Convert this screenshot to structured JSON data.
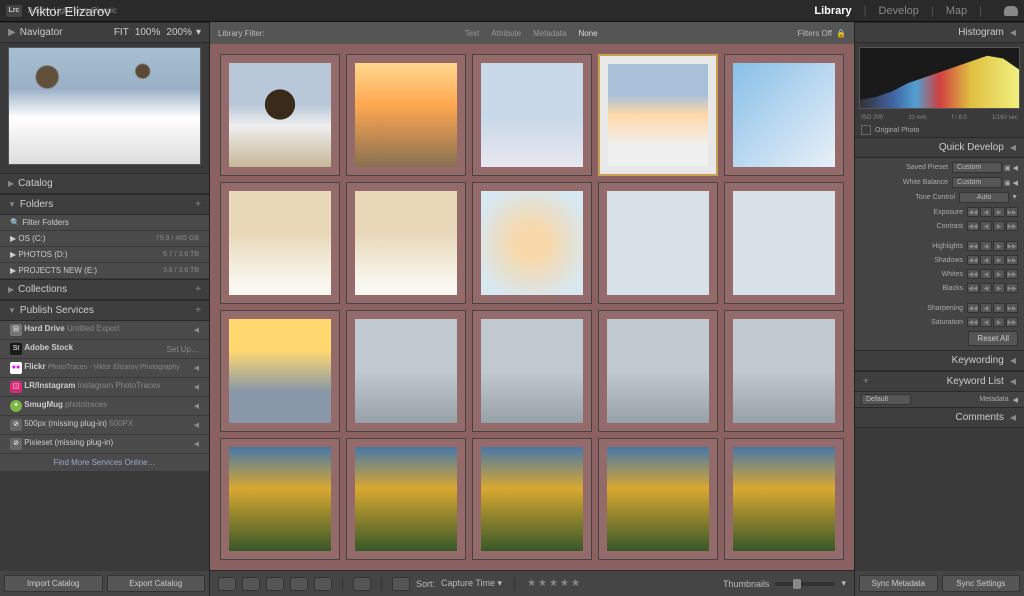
{
  "app": {
    "name": "Adobe Lightroom Classic",
    "user": "Viktor Elizarov"
  },
  "modules": {
    "library": "Library",
    "develop": "Develop",
    "map": "Map"
  },
  "navigator": {
    "title": "Navigator",
    "fit": "FIT",
    "z100": "100%",
    "z200": "200%"
  },
  "catalog": {
    "title": "Catalog"
  },
  "folders": {
    "title": "Folders",
    "filter": "Filter Folders",
    "drives": [
      {
        "name": "OS (C:)",
        "info": "79.9 / 465 GB"
      },
      {
        "name": "PHOTOS (D:)",
        "info": "6.7 / 3.6 TB"
      },
      {
        "name": "PROJECTS NEW (E:)",
        "info": "3.6 / 3.6 TB"
      }
    ]
  },
  "collections": {
    "title": "Collections"
  },
  "publish": {
    "title": "Publish Services",
    "find_more": "Find More Services Online…",
    "services": [
      {
        "icon": "hd",
        "name": "Hard Drive",
        "sub": "Untitled Export"
      },
      {
        "icon": "st",
        "name": "Adobe Stock",
        "sub": "Set Up…"
      },
      {
        "icon": "fl",
        "name": "Flickr",
        "sub": "PhotoTraces - Viktor Elizarov Photography"
      },
      {
        "icon": "ig",
        "name": "LR/Instagram",
        "sub": "Instagram PhotoTraces"
      },
      {
        "icon": "sm",
        "name": "SmugMug",
        "sub": "phototraces"
      },
      {
        "icon": "",
        "name": "500px (missing plug-in)",
        "sub": "500PX"
      },
      {
        "icon": "",
        "name": "Pixieset (missing plug-in)",
        "sub": ""
      }
    ]
  },
  "left_buttons": {
    "import": "Import Catalog",
    "export": "Export Catalog"
  },
  "filter": {
    "label": "Library Filter:",
    "text": "Text",
    "attribute": "Attribute",
    "metadata": "Metadata",
    "none": "None",
    "filters_off": "Filters Off"
  },
  "toolbar": {
    "sort": "Sort:",
    "sort_by": "Capture Time",
    "thumbnails": "Thumbnails"
  },
  "right": {
    "histogram": {
      "title": "Histogram",
      "iso": "ISO 200",
      "focal": "10 mm",
      "aperture": "f / 8.0",
      "shutter": "1/160 sec",
      "original": "Original Photo"
    },
    "quickdev": {
      "title": "Quick Develop",
      "saved_preset": "Saved Preset",
      "custom": "Custom",
      "white_balance": "White Balance",
      "tone_control": "Tone Control",
      "auto": "Auto",
      "exposure": "Exposure",
      "contrast": "Contrast",
      "highlights": "Highlights",
      "shadows": "Shadows",
      "whites": "Whites",
      "blacks": "Blacks",
      "sharpening": "Sharpening",
      "saturation": "Saturation",
      "reset": "Reset All"
    },
    "keywording": "Keywording",
    "keyword_list": "Keyword List",
    "metadata": "Metadata",
    "metadata_preset": "Default",
    "comments": "Comments",
    "sync_meta": "Sync Metadata",
    "sync_settings": "Sync Settings"
  }
}
